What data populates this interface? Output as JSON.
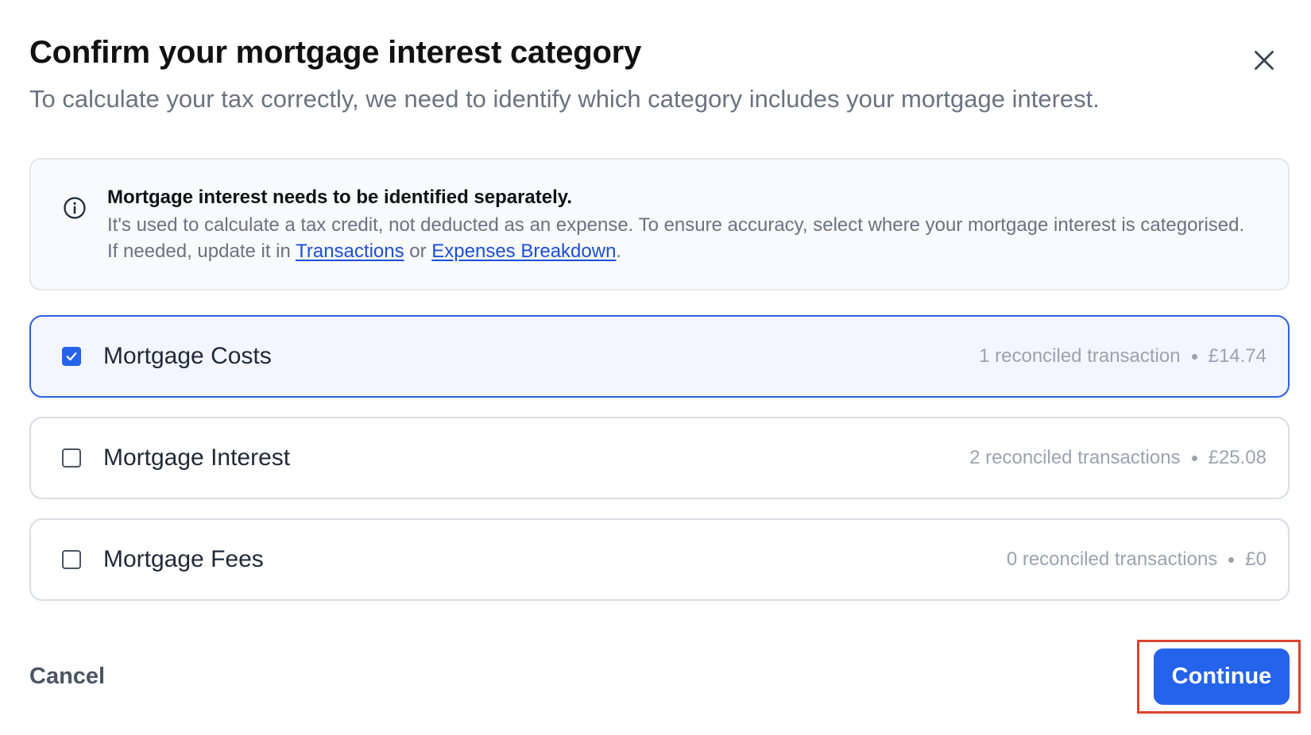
{
  "dialog": {
    "title": "Confirm your mortgage interest category",
    "subtitle": "To calculate your tax correctly, we need to identify which category includes your mortgage interest."
  },
  "info": {
    "icon": "info-circle-icon",
    "heading": "Mortgage interest needs to be identified separately.",
    "body_prefix": "It's used to calculate a tax credit, not deducted as an expense. To ensure accuracy, select where your mortgage interest is categorised. If needed, update it in ",
    "link_transactions": "Transactions",
    "body_or": " or ",
    "link_expenses": "Expenses Breakdown",
    "body_suffix": "."
  },
  "options": [
    {
      "label": "Mortgage Costs",
      "transactions": "1 reconciled transaction",
      "amount": "£14.74",
      "checked": true
    },
    {
      "label": "Mortgage Interest",
      "transactions": "2 reconciled transactions",
      "amount": "£25.08",
      "checked": false
    },
    {
      "label": "Mortgage Fees",
      "transactions": "0 reconciled transactions",
      "amount": "£0",
      "checked": false
    }
  ],
  "footer": {
    "cancel_label": "Cancel",
    "continue_label": "Continue"
  },
  "colors": {
    "accent": "#2563eb",
    "selected_border": "#2f5fe0",
    "highlight": "#d9442f"
  }
}
